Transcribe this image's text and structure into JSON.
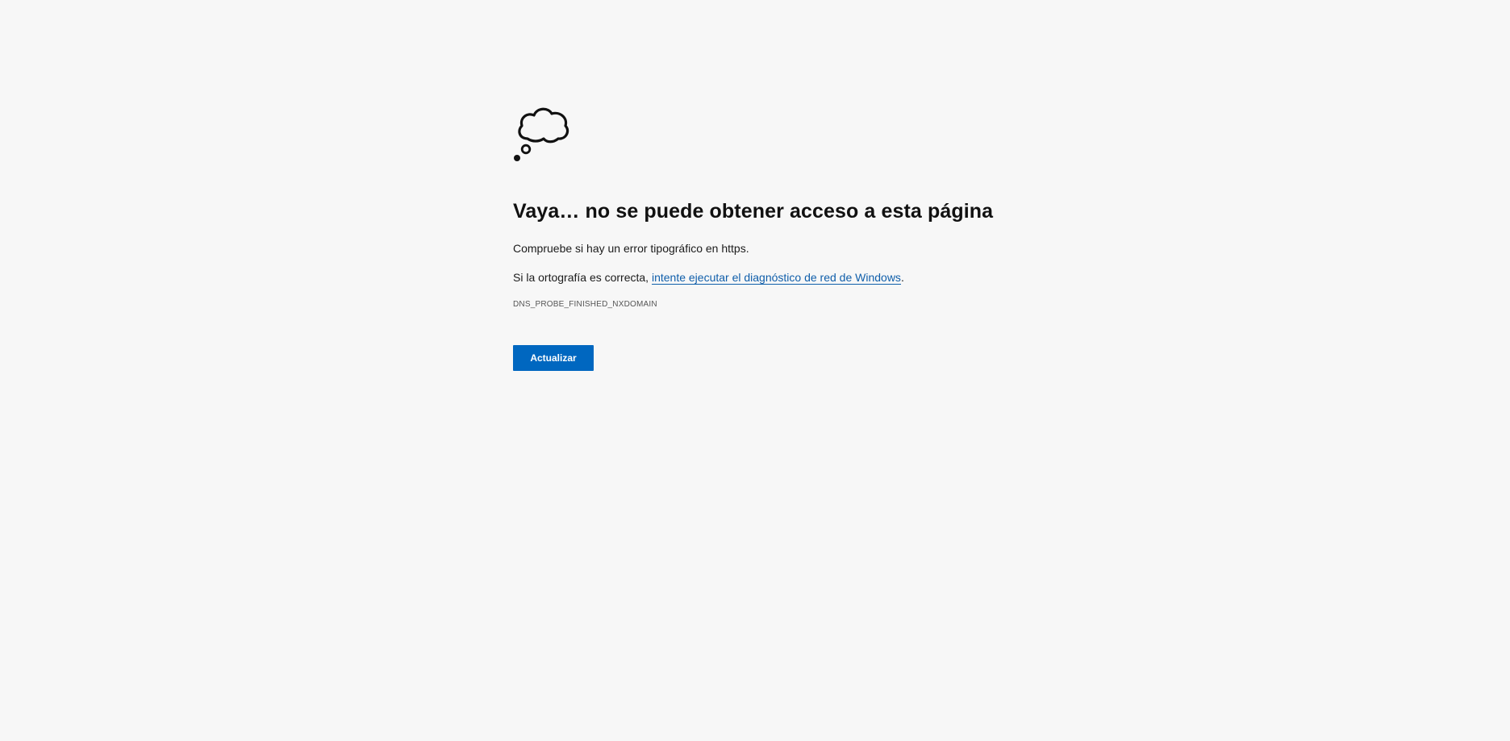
{
  "icon": "thought-cloud-icon",
  "error": {
    "title": "Vaya… no se puede obtener acceso a esta página",
    "line1": "Compruebe si hay un error tipográfico en https.",
    "line2_prefix": "Si la ortografía es correcta, ",
    "line2_link": "intente ejecutar el diagnóstico de red de Windows",
    "line2_suffix": ".",
    "code": "DNS_PROBE_FINISHED_NXDOMAIN"
  },
  "actions": {
    "refresh_label": "Actualizar"
  },
  "colors": {
    "background": "#f7f7f7",
    "link": "#0f5eaa",
    "button": "#0067c0"
  }
}
